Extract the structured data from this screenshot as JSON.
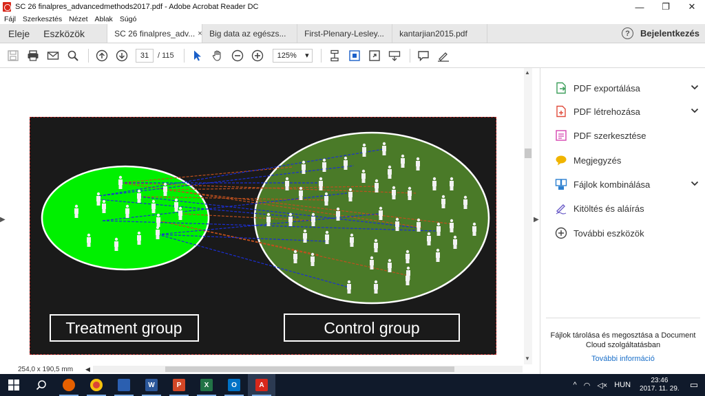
{
  "window": {
    "title": "SC 26 finalpres_advancedmethods2017.pdf - Adobe Acrobat Reader DC",
    "minimize": "—",
    "maximize": "❐",
    "close": "✕"
  },
  "menu": [
    "Fájl",
    "Szerkesztés",
    "Nézet",
    "Ablak",
    "Súgó"
  ],
  "tabs": {
    "home": "Eleje",
    "tools": "Eszközök",
    "docs": [
      {
        "label": "SC 26 finalpres_adv...",
        "active": true
      },
      {
        "label": "Big data az egészs...",
        "active": false
      },
      {
        "label": "First-Plenary-Lesley...",
        "active": false
      },
      {
        "label": "kantarjian2015.pdf",
        "active": false
      }
    ],
    "close_glyph": "×",
    "help": "?",
    "signin": "Bejelentkezés"
  },
  "toolbar": {
    "page_current": "31",
    "page_total": "/ 115",
    "zoom": "125%",
    "zoom_arrow": "▾"
  },
  "slide": {
    "treatment_label": "Treatment group",
    "control_label": "Control group",
    "colors": {
      "background": "#1a1a1a",
      "treatment_fill": "#00f000",
      "control_fill": "#4a7a28",
      "match_blue": "#1b2fd6",
      "match_red": "#c0501e"
    }
  },
  "status": {
    "dimensions": "254,0 x 190,5 mm"
  },
  "right_pane": {
    "tools": [
      {
        "label": "PDF exportálása",
        "icon": "export-pdf-icon",
        "color": "#3c9e5a",
        "expand": true
      },
      {
        "label": "PDF létrehozása",
        "icon": "create-pdf-icon",
        "color": "#e04c3c",
        "expand": true
      },
      {
        "label": "PDF szerkesztése",
        "icon": "edit-pdf-icon",
        "color": "#d645b0",
        "expand": false
      },
      {
        "label": "Megjegyzés",
        "icon": "comment-icon",
        "color": "#f0b400",
        "expand": false
      },
      {
        "label": "Fájlok kombinálása",
        "icon": "combine-files-icon",
        "color": "#2b7fd0",
        "expand": true
      },
      {
        "label": "Kitöltés és aláírás",
        "icon": "fill-sign-icon",
        "color": "#6a5cc8",
        "expand": false
      },
      {
        "label": "További eszközök",
        "icon": "more-tools-icon",
        "color": "#444444",
        "expand": false
      }
    ],
    "share_text": "Fájlok tárolása és megosztása a Document Cloud szolgáltatásban",
    "more_info": "További információ",
    "chevron": "⌄"
  },
  "taskbar": {
    "language": "HUN",
    "time": "23:46",
    "date": "2017. 11. 29."
  }
}
